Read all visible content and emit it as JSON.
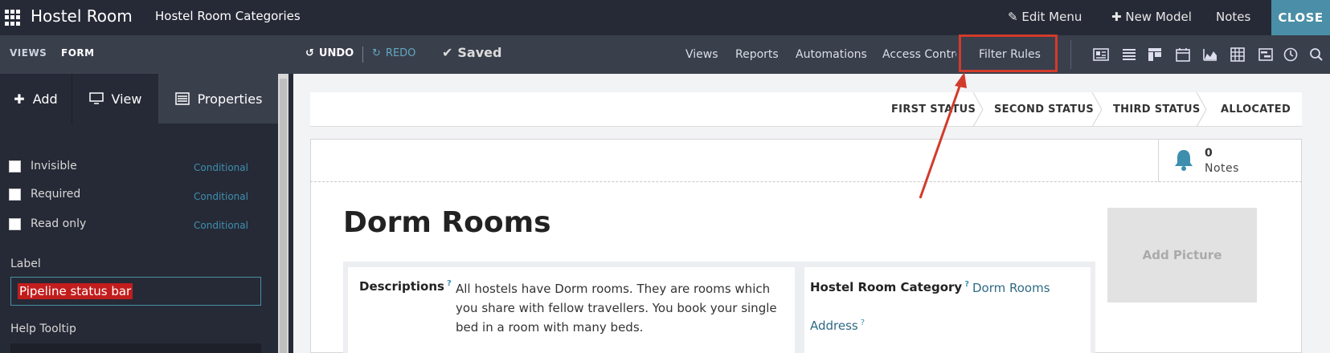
{
  "topbar": {
    "app_title": "Hostel Room",
    "model_title": "Hostel Room Categories",
    "edit_menu": "Edit Menu",
    "new_model": "New Model",
    "notes": "Notes",
    "close": "CLOSE"
  },
  "subbar": {
    "views_tab": "VIEWS",
    "form_tab": "FORM",
    "undo": "UNDO",
    "redo": "REDO",
    "saved": "Saved",
    "links": [
      "Views",
      "Reports",
      "Automations",
      "Access Contro",
      "Filter Rules"
    ],
    "view_icons": [
      "form-view-icon",
      "list-view-icon",
      "kanban-view-icon",
      "calendar-view-icon",
      "graph-view-icon",
      "pivot-view-icon",
      "gantt-view-icon",
      "activity-view-icon",
      "search-view-icon"
    ]
  },
  "sidebar": {
    "tabs": [
      "Add",
      "View",
      "Properties"
    ],
    "properties": [
      {
        "label": "Invisible",
        "conditional": "Conditional"
      },
      {
        "label": "Required",
        "conditional": "Conditional"
      },
      {
        "label": "Read only",
        "conditional": "Conditional"
      }
    ],
    "label_title": "Label",
    "label_value": "Pipeline status bar",
    "help_tooltip": "Help Tooltip"
  },
  "form": {
    "statuses": [
      "FIRST STATUS",
      "SECOND STATUS",
      "THIRD STATUS",
      "ALLOCATED"
    ],
    "notes_count": "0",
    "notes_label": "Notes",
    "title": "Dorm Rooms",
    "add_picture": "Add Picture",
    "descriptions_label": "Descriptions",
    "descriptions_value": "All hostels have Dorm rooms. They are rooms which you share with fellow travellers. You book your single bed in a room with many beds.",
    "category_label": "Hostel Room Category",
    "category_value": "Dorm Rooms",
    "address_label": "Address",
    "help_mark": "?"
  },
  "colors": {
    "topbar_bg": "#262a36",
    "subbar_bg": "#3a3f4c",
    "accent": "#4a8ea7",
    "highlight": "#d23b2a"
  }
}
